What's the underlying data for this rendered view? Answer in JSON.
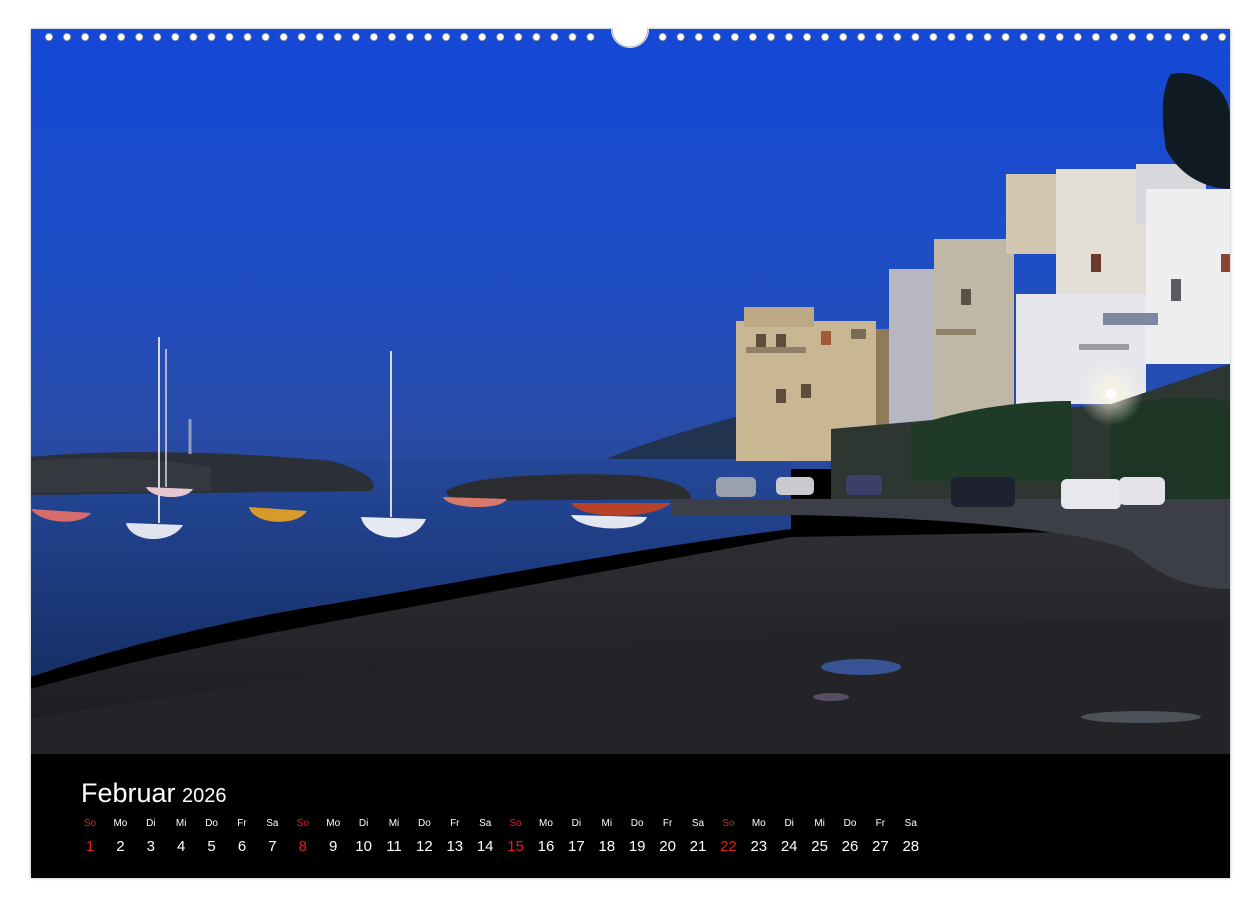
{
  "calendar": {
    "month": "Februar",
    "year": "2026",
    "days": [
      {
        "wd": "So",
        "num": "1",
        "sunday": true
      },
      {
        "wd": "Mo",
        "num": "2"
      },
      {
        "wd": "Di",
        "num": "3"
      },
      {
        "wd": "Mi",
        "num": "4"
      },
      {
        "wd": "Do",
        "num": "5"
      },
      {
        "wd": "Fr",
        "num": "6"
      },
      {
        "wd": "Sa",
        "num": "7"
      },
      {
        "wd": "So",
        "num": "8",
        "sunday": true
      },
      {
        "wd": "Mo",
        "num": "9"
      },
      {
        "wd": "Di",
        "num": "10"
      },
      {
        "wd": "Mi",
        "num": "11"
      },
      {
        "wd": "Do",
        "num": "12"
      },
      {
        "wd": "Fr",
        "num": "13"
      },
      {
        "wd": "Sa",
        "num": "14"
      },
      {
        "wd": "So",
        "num": "15",
        "sunday": true
      },
      {
        "wd": "Mo",
        "num": "16"
      },
      {
        "wd": "Di",
        "num": "17"
      },
      {
        "wd": "Mi",
        "num": "18"
      },
      {
        "wd": "Do",
        "num": "19"
      },
      {
        "wd": "Fr",
        "num": "20"
      },
      {
        "wd": "Sa",
        "num": "21"
      },
      {
        "wd": "So",
        "num": "22",
        "sunday": true
      },
      {
        "wd": "Mo",
        "num": "23"
      },
      {
        "wd": "Di",
        "num": "24"
      },
      {
        "wd": "Mi",
        "num": "25"
      },
      {
        "wd": "Do",
        "num": "26"
      },
      {
        "wd": "Fr",
        "num": "27"
      },
      {
        "wd": "Sa",
        "num": "28"
      }
    ]
  },
  "colors": {
    "sunday": "#e02020",
    "weekday": "#ffffff",
    "calendar_background": "#000000",
    "sky": "#1c4fd8"
  },
  "icons": {
    "binding": "spiral-binding-holes",
    "hanger": "hanger-notch"
  }
}
